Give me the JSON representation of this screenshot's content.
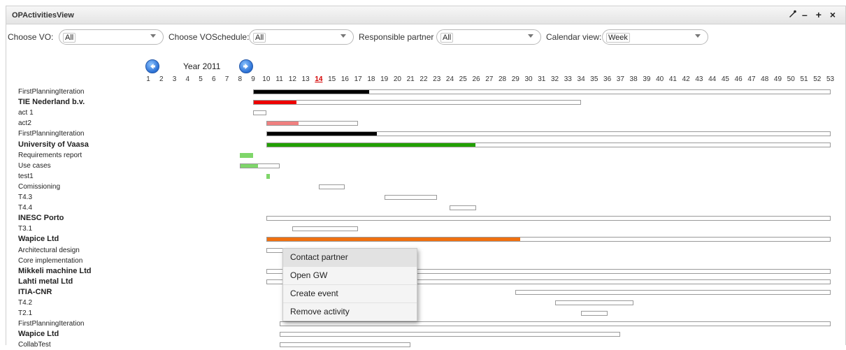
{
  "window": {
    "title": "OPActivitiesView",
    "icons": [
      "wrench-icon",
      "minimize-icon",
      "maximize-icon",
      "close-icon"
    ]
  },
  "filters": {
    "vo_label": "Choose VO:",
    "vo_value": "All",
    "schedule_label": "Choose VOSchedule:",
    "schedule_value": "All",
    "partner_label": "Responsible partner",
    "partner_value": "All",
    "calendar_label": "Calendar view:",
    "calendar_value": "Week"
  },
  "year_nav": {
    "label": "Year 2011",
    "prev_icon": "arrow-left-icon",
    "next_icon": "arrow-right-icon"
  },
  "current_week": 14,
  "weeks": [
    1,
    2,
    3,
    4,
    5,
    6,
    7,
    8,
    9,
    10,
    11,
    12,
    13,
    14,
    15,
    16,
    17,
    18,
    19,
    20,
    21,
    22,
    23,
    24,
    25,
    26,
    27,
    28,
    29,
    30,
    31,
    32,
    33,
    34,
    35,
    36,
    37,
    38,
    39,
    40,
    41,
    42,
    43,
    44,
    45,
    46,
    47,
    48,
    49,
    50,
    51,
    52,
    53
  ],
  "rows": [
    {
      "label": "FirstPlanningIteration",
      "bold": false,
      "start": 9,
      "end": 53,
      "progress": 0.2,
      "color": "#000000"
    },
    {
      "label": "TIE Nederland b.v.",
      "bold": true,
      "start": 9,
      "end": 34,
      "progress": 0.13,
      "color": "#ee0000"
    },
    {
      "label": "act 1",
      "bold": false,
      "start": 9,
      "end": 10,
      "progress": 0,
      "color": "#ffffff"
    },
    {
      "label": "act2",
      "bold": false,
      "start": 10,
      "end": 17,
      "progress": 0.35,
      "color": "#f08080"
    },
    {
      "label": "FirstPlanningIteration",
      "bold": false,
      "start": 10,
      "end": 53,
      "progress": 0.195,
      "color": "#000000"
    },
    {
      "label": "University of Vaasa",
      "bold": true,
      "start": 10,
      "end": 53,
      "progress": 0.37,
      "color": "#22a000"
    },
    {
      "label": "Requirements report",
      "bold": false,
      "start": 8,
      "end": 9,
      "progress": 1,
      "color": "#7fd66a"
    },
    {
      "label": "Use cases",
      "bold": false,
      "start": 8,
      "end": 11,
      "progress": 0.45,
      "color": "#7fd66a"
    },
    {
      "label": "test1",
      "bold": false,
      "start": 10,
      "end": 10.3,
      "progress": 1,
      "color": "#7fd66a"
    },
    {
      "label": "Comissioning",
      "bold": false,
      "start": 14,
      "end": 16,
      "progress": 0,
      "color": "#ffffff"
    },
    {
      "label": "T4.3",
      "bold": false,
      "start": 19,
      "end": 23,
      "progress": 0,
      "color": "#ffffff"
    },
    {
      "label": "T4.4",
      "bold": false,
      "start": 24,
      "end": 26,
      "progress": 0,
      "color": "#ffffff"
    },
    {
      "label": "INESC Porto",
      "bold": true,
      "start": 10,
      "end": 53,
      "progress": 0,
      "color": "#ffffff"
    },
    {
      "label": "T3.1",
      "bold": false,
      "start": 12,
      "end": 17,
      "progress": 0,
      "color": "#ffffff"
    },
    {
      "label": "Wapice Ltd",
      "bold": true,
      "start": 10,
      "end": 53,
      "progress": 0.45,
      "color": "#f07010"
    },
    {
      "label": "Architectural design",
      "bold": false,
      "start": 10,
      "end": 12,
      "progress": 0,
      "color": "#ffffff"
    },
    {
      "label": "Core implementation",
      "bold": false,
      "start": null,
      "end": null,
      "progress": 0,
      "color": "#ffffff"
    },
    {
      "label": "Mikkeli machine Ltd",
      "bold": true,
      "start": 10,
      "end": 53,
      "progress": 0,
      "color": "#ffffff"
    },
    {
      "label": "Lahti metal Ltd",
      "bold": true,
      "start": 10,
      "end": 53,
      "progress": 0,
      "color": "#ffffff"
    },
    {
      "label": "ITIA-CNR",
      "bold": true,
      "start": 29,
      "end": 53,
      "progress": 0,
      "color": "#ffffff"
    },
    {
      "label": "T4.2",
      "bold": false,
      "start": 32,
      "end": 38,
      "progress": 0,
      "color": "#ffffff"
    },
    {
      "label": "T2.1",
      "bold": false,
      "start": 34,
      "end": 36,
      "progress": 0,
      "color": "#ffffff"
    },
    {
      "label": "FirstPlanningIteration",
      "bold": false,
      "start": 11,
      "end": 53,
      "progress": 0,
      "color": "#ffffff"
    },
    {
      "label": "Wapice Ltd",
      "bold": true,
      "start": 11,
      "end": 37,
      "progress": 0,
      "color": "#ffffff"
    },
    {
      "label": "CollabTest",
      "bold": false,
      "start": 11,
      "end": 21,
      "progress": 0,
      "color": "#ffffff"
    }
  ],
  "context_menu": {
    "items": [
      "Contact partner",
      "Open GW",
      "Create event",
      "Remove activity"
    ],
    "highlighted": 0
  }
}
